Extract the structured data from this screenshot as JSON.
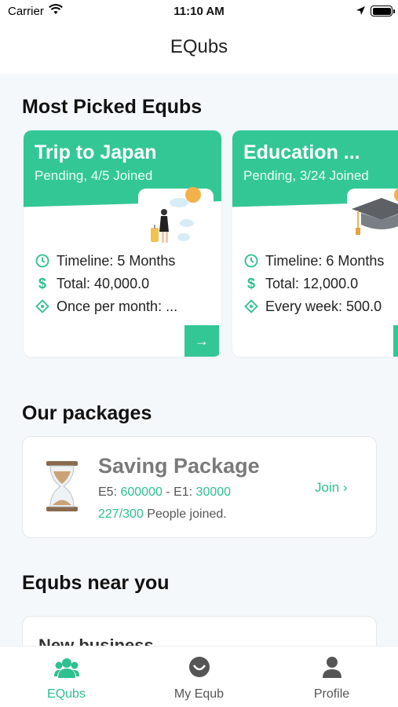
{
  "status": {
    "carrier": "Carrier",
    "time": "11:10 AM"
  },
  "nav": {
    "title": "EQubs"
  },
  "sections": {
    "most_picked": "Most Picked Equbs",
    "packages": "Our packages",
    "near": "Equbs near you"
  },
  "cards": [
    {
      "title": "Trip to Japan",
      "status": "Pending, 4/5 Joined",
      "timeline": "Timeline: 5 Months",
      "total": "Total: 40,000.0",
      "frequency": "Once per month: ..."
    },
    {
      "title": "Education ...",
      "status": "Pending, 3/24 Joined",
      "timeline": "Timeline: 6 Months",
      "total": "Total: 12,000.0",
      "frequency": "Every week: 500.0"
    }
  ],
  "package": {
    "title": "Saving Package",
    "e5_label": "E5: ",
    "e5_value": "600000",
    "sep": " - ",
    "e1_label": "E1: ",
    "e1_value": "30000",
    "joined_count": "227/300",
    "joined_text": " People joined.",
    "join": "Join"
  },
  "near_card": {
    "title": "New business"
  },
  "tabs": [
    {
      "label": "EQubs",
      "active": true
    },
    {
      "label": "My Equb",
      "active": false
    },
    {
      "label": "Profile",
      "active": false
    }
  ],
  "colors": {
    "accent": "#33c795",
    "accent_text": "#2ec08e",
    "background": "#f5f8fa",
    "badge": "#f2b24a"
  }
}
